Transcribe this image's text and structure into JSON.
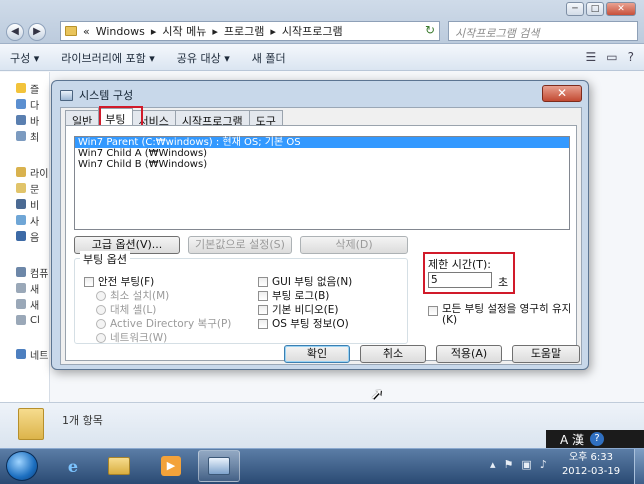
{
  "explorer": {
    "caption_buttons": [
      "─",
      "□",
      "✕"
    ],
    "address": {
      "parts": [
        "«",
        "Windows",
        "▸",
        "시작 메뉴",
        "▸",
        "프로그램",
        "▸",
        "시작프로그램"
      ]
    },
    "search_placeholder": "시작프로그램 검색",
    "toolbar": {
      "organize": "구성 ▾",
      "include_library": "라이브러리에 포함 ▾",
      "share": "공유 대상 ▾",
      "new_folder": "새 폴더"
    },
    "nav_items": [
      "즐",
      "다",
      "바",
      "최",
      "라이",
      "문",
      "비",
      "사",
      "음",
      "컴퓨",
      "새",
      "새",
      "Cl",
      "네트"
    ],
    "status": "1개 항목"
  },
  "dialog": {
    "title": "시스템 구성",
    "close_label": "✕",
    "tabs": [
      "일반",
      "부팅",
      "서비스",
      "시작프로그램",
      "도구"
    ],
    "os_entries": [
      "Win7 Parent (C:₩windows) : 현재 OS; 기본 OS",
      "Win7 Child A (₩Windows)",
      "Win7 Child B (₩Windows)"
    ],
    "buttons": {
      "advanced": "고급 옵션(V)...",
      "set_default": "기본값으로 설정(S)",
      "delete": "삭제(D)",
      "ok": "확인",
      "cancel": "취소",
      "apply": "적용(A)",
      "help": "도움말"
    },
    "boot_options": {
      "label": "부팅 옵션",
      "safe_boot": "안전 부팅(F)",
      "minimal": "최소 설치(M)",
      "alternate_shell": "대체 셸(L)",
      "ad_repair": "Active Directory 복구(P)",
      "network": "네트워크(W)",
      "no_gui": "GUI 부팅 없음(N)",
      "boot_log": "부팅 로그(B)",
      "base_video": "기본 비디오(E)",
      "os_boot_info": "OS 부팅 정보(O)"
    },
    "timeout": {
      "label": "제한 시간(T):",
      "value": "5",
      "unit": "초"
    },
    "make_permanent": "모든 부팅 설정을 영구히 유지(K)"
  },
  "taskbar": {
    "language": "A 漢",
    "help_icon_label": "?",
    "clock_time": "오후 6:33",
    "clock_date": "2012-03-19"
  },
  "colors": {
    "highlight": "#d11a2a",
    "selection": "#3399ff",
    "taskbar": "#2a4a73"
  }
}
